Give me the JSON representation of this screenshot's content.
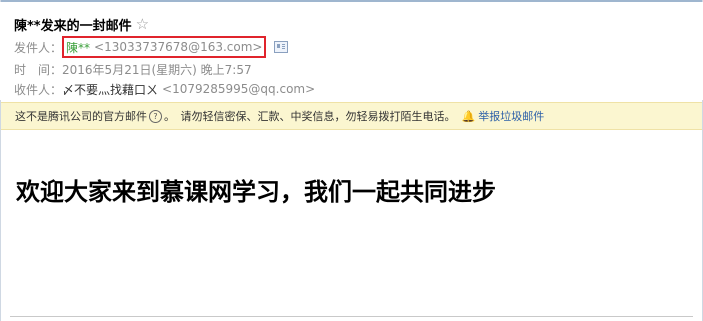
{
  "email": {
    "subject": "陳**发来的一封邮件",
    "star_icon": "☆",
    "from_label": "发件人：",
    "from_name": "陳**",
    "from_address": "<13033737678@163.com>",
    "time_label": "时　间：",
    "time_value": "2016年5月21日(星期六) 晚上7:57",
    "to_label": "收件人：",
    "to_name": "〆不要灬找藉口ㄨ",
    "to_address": "<1079285995@qq.com>"
  },
  "notice": {
    "official_text": "这不是腾讯公司的官方邮件",
    "help_icon": "?",
    "warning_text": "。　请勿轻信密保、汇款、中奖信息，勿轻易拨打陌生电话。",
    "spam_icon": "🔔",
    "report_spam_label": "举报垃圾邮件"
  },
  "body": {
    "heading": "欢迎大家来到慕课网学习，我们一起共同进步"
  },
  "colors": {
    "highlight_border": "#e0242c",
    "sender_name": "#3aa03a",
    "notice_bg": "#fbf6d0",
    "link": "#2c5fa8"
  }
}
